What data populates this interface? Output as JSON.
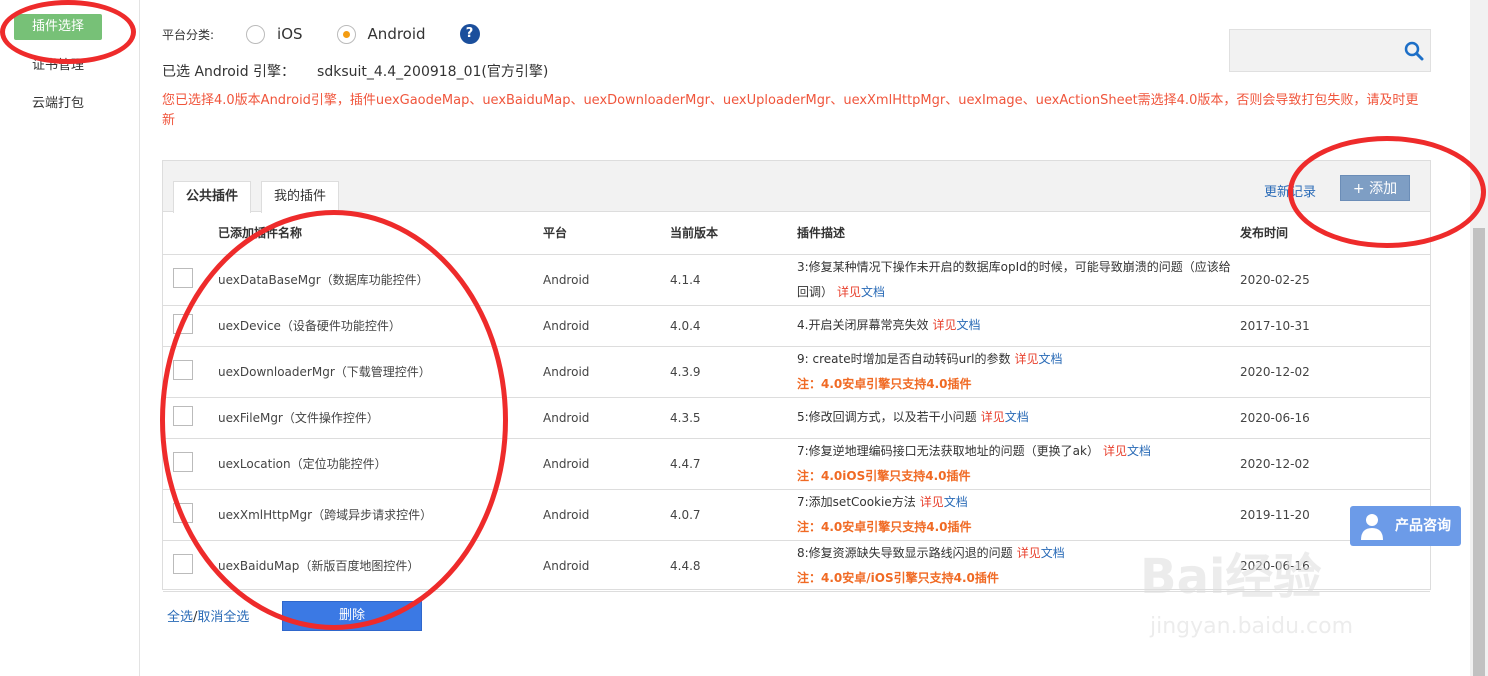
{
  "sidebar": {
    "items": [
      {
        "label": "插件选择",
        "active": true
      },
      {
        "label": "证书管理",
        "active": false
      },
      {
        "label": "云端打包",
        "active": false
      }
    ]
  },
  "platform": {
    "label": "平台分类:",
    "options": [
      "iOS",
      "Android"
    ],
    "selected": "Android",
    "help_icon": "?"
  },
  "engine": {
    "label": "已选 Android 引擎：",
    "value": "sdksuit_4.4_200918_01(官方引擎)"
  },
  "warning": "您已选择4.0版本Android引擎，插件uexGaodeMap、uexBaiduMap、uexDownloaderMgr、uexUploaderMgr、uexXmlHttpMgr、uexImage、uexActionSheet需选择4.0版本，否则会导致打包失败，请及时更新",
  "search": {
    "placeholder": ""
  },
  "tabs": [
    "公共插件",
    "我的插件"
  ],
  "update_record": "更新记录",
  "add_button": "+ 添加",
  "table": {
    "headers": [
      "已添加插件名称",
      "平台",
      "当前版本",
      "插件描述",
      "发布时间"
    ],
    "rows": [
      {
        "name": "uexDataBaseMgr（数据库功能控件）",
        "platform": "Android",
        "version": "4.1.4",
        "desc": "3:修复某种情况下操作未开启的数据库opId的时候，可能导致崩溃的问题（应该给回调）",
        "note": "",
        "date": "2020-02-25"
      },
      {
        "name": "uexDevice（设备硬件功能控件）",
        "platform": "Android",
        "version": "4.0.4",
        "desc": "4.开启关闭屏幕常亮失效",
        "note": "",
        "date": "2017-10-31"
      },
      {
        "name": "uexDownloaderMgr（下载管理控件）",
        "platform": "Android",
        "version": "4.3.9",
        "desc": "9: create时增加是否自动转码url的参数",
        "note": "注：4.0安卓引擎只支持4.0插件",
        "date": "2020-12-02"
      },
      {
        "name": "uexFileMgr（文件操作控件）",
        "platform": "Android",
        "version": "4.3.5",
        "desc": "5:修改回调方式，以及若干小问题",
        "note": "",
        "date": "2020-06-16"
      },
      {
        "name": "uexLocation（定位功能控件）",
        "platform": "Android",
        "version": "4.4.7",
        "desc": "7:修复逆地理编码接口无法获取地址的问题（更换了ak）",
        "note": "注：4.0iOS引擎只支持4.0插件",
        "date": "2020-12-02"
      },
      {
        "name": "uexXmlHttpMgr（跨域异步请求控件）",
        "platform": "Android",
        "version": "4.0.7",
        "desc": "7:添加setCookie方法",
        "note": "注：4.0安卓引擎只支持4.0插件",
        "date": "2019-11-20"
      },
      {
        "name": "uexBaiduMap（新版百度地图控件）",
        "platform": "Android",
        "version": "4.4.8",
        "desc": "8:修复资源缺失导致显示路线闪退的问题",
        "note": "注：4.0安卓/iOS引擎只支持4.0插件",
        "date": "2020-06-16"
      }
    ],
    "link_detail": "详见",
    "link_doc": "文档"
  },
  "footer": {
    "select_all": "全选",
    "separator": "/",
    "deselect_all": "取消全选",
    "delete_button": "删除"
  },
  "consult_button": "产品咨询",
  "watermark": {
    "brand": "Bai经验",
    "url": "jingyan.baidu.com"
  },
  "colors": {
    "active_green": "#77c177",
    "warning_red": "#f0553c",
    "link_blue": "#2a6bb7",
    "annotation_red": "#ee2b2b"
  }
}
